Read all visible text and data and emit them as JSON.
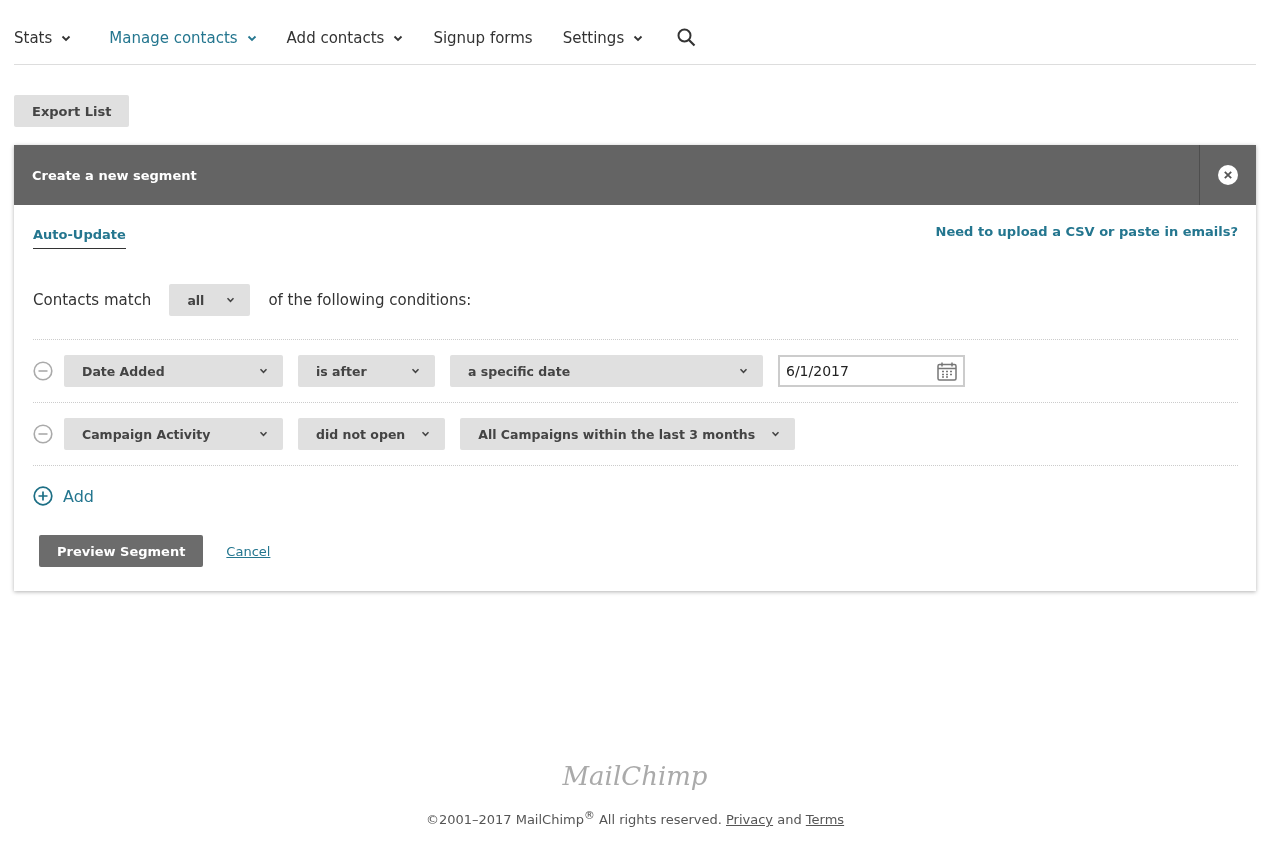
{
  "nav": [
    {
      "label": "Stats",
      "selected": false,
      "caret": true
    },
    {
      "label": "Manage contacts",
      "selected": true,
      "caret": true
    },
    {
      "label": "Add contacts",
      "selected": false,
      "caret": true
    },
    {
      "label": "Signup forms",
      "selected": false,
      "caret": false
    },
    {
      "label": "Settings",
      "selected": false,
      "caret": true
    }
  ],
  "export_button": "Export List",
  "segment": {
    "title": "Create a new segment",
    "tabs": [
      {
        "label": "Auto-Update",
        "selected": true
      }
    ],
    "upload_link": "Need to upload a CSV or paste in emails?",
    "match": {
      "prefix": "Contacts match",
      "value": "all",
      "suffix": "of the following conditions:"
    },
    "conditions": [
      {
        "fields": [
          {
            "kind": "select",
            "value": "Date Added"
          },
          {
            "kind": "select",
            "value": "is after"
          },
          {
            "kind": "select",
            "value": "a specific date"
          },
          {
            "kind": "date",
            "value": "6/1/2017"
          }
        ]
      },
      {
        "fields": [
          {
            "kind": "select",
            "value": "Campaign Activity"
          },
          {
            "kind": "select",
            "value": "did not open"
          },
          {
            "kind": "select",
            "value": "All Campaigns within the last 3 months"
          }
        ]
      }
    ],
    "add_label": "Add",
    "preview_button": "Preview Segment",
    "cancel_link": "Cancel"
  },
  "footer": {
    "logo": "MailChimp",
    "copyright": "©2001–2017 MailChimp$^{®}$ All rights reserved.",
    "links": [
      "Privacy",
      "Terms"
    ],
    "joiner": "and"
  }
}
